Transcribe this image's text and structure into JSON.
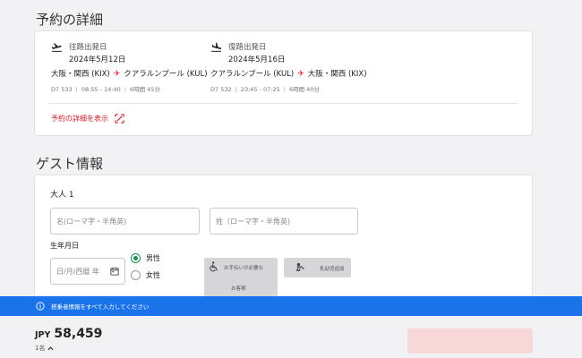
{
  "reservation": {
    "title": "予約の詳細",
    "outbound": {
      "type": "往路出発日",
      "date": "2024年5月12日",
      "origin": "大阪・関西 (KIX)",
      "destination": "クアラルンプール (KUL)",
      "flight": "D7 533",
      "times": "08:55 - 14:40",
      "duration": "6時間 45分"
    },
    "inbound": {
      "type": "復路出発日",
      "date": "2024年5月16日",
      "origin": "クアラルンプール (KUL)",
      "destination": "大阪・関西 (KIX)",
      "flight": "D7 532",
      "times": "23:45 - 07:25",
      "duration": "6時間 40分"
    },
    "details_link": "予約の詳細を表示",
    "arrow": "✈",
    "separator": "|"
  },
  "guest": {
    "title": "ゲスト情報",
    "adult_label": "大人 1",
    "first_name_placeholder": "名(ローマ字・半角英)",
    "last_name_placeholder": "姓（ローマ字・半角英)",
    "dob_label": "生年月日",
    "dob_placeholder": "日/月/西暦 年",
    "gender_male": "男性",
    "gender_female": "女性",
    "gender_selected": "男性",
    "assist_label_1": "お手伝いが必要な",
    "assist_label_2": "お客様",
    "infant_label": "乳幼児追加"
  },
  "banner": {
    "message": "搭乗者情報をすべて入力してください"
  },
  "footer": {
    "currency": "JPY",
    "amount": "58,459",
    "pax": "1名"
  },
  "colors": {
    "accent_red": "#e0202d",
    "banner_blue": "#1a73e8",
    "radio_green": "#1c8b53",
    "disabled_button": "#f8d7d9"
  }
}
